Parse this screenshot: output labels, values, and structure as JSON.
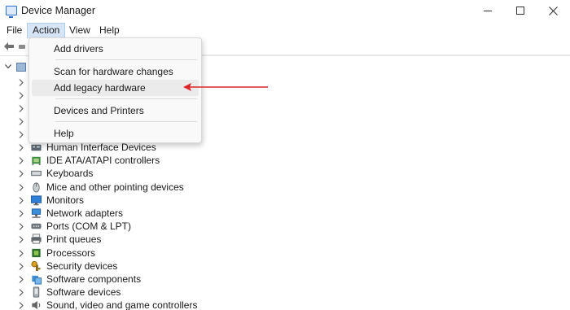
{
  "window": {
    "title": "Device Manager"
  },
  "menu": {
    "file": "File",
    "action": "Action",
    "view": "View",
    "help": "Help"
  },
  "dropdown": {
    "items": [
      {
        "label": "Add drivers"
      },
      {
        "label": "Scan for hardware changes"
      },
      {
        "label": "Add legacy hardware"
      },
      {
        "label": "Devices and Printers"
      },
      {
        "label": "Help"
      }
    ],
    "hovered_item": "Add legacy hardware"
  },
  "tree": {
    "categories": [
      {
        "label": "Human Interface Devices",
        "icon": "hid-icon"
      },
      {
        "label": "IDE ATA/ATAPI controllers",
        "icon": "ide-controller-icon"
      },
      {
        "label": "Keyboards",
        "icon": "keyboard-icon"
      },
      {
        "label": "Mice and other pointing devices",
        "icon": "mouse-icon"
      },
      {
        "label": "Monitors",
        "icon": "monitor-icon"
      },
      {
        "label": "Network adapters",
        "icon": "network-adapter-icon"
      },
      {
        "label": "Ports (COM & LPT)",
        "icon": "port-icon"
      },
      {
        "label": "Print queues",
        "icon": "printer-icon"
      },
      {
        "label": "Processors",
        "icon": "processor-icon"
      },
      {
        "label": "Security devices",
        "icon": "security-key-icon"
      },
      {
        "label": "Software components",
        "icon": "software-component-icon"
      },
      {
        "label": "Software devices",
        "icon": "software-device-icon"
      },
      {
        "label": "Sound, video and game controllers",
        "icon": "sound-icon"
      }
    ]
  },
  "colors": {
    "annotation_arrow": "#e0242b",
    "menu_highlight": "#d6e6f7",
    "item_hover": "#ebebeb"
  }
}
